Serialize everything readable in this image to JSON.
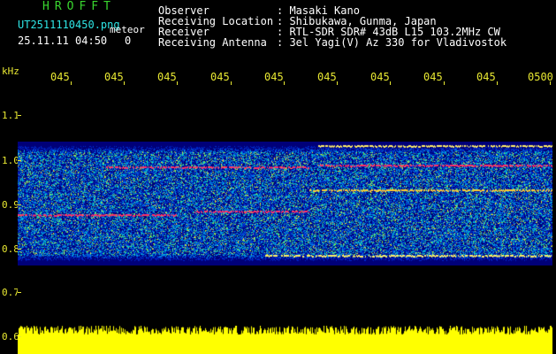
{
  "header": {
    "app_title": "HROFFT",
    "filename": "UT2511110450.png",
    "meteor_label": "meteor",
    "datetime": "25.11.11 04:50",
    "count": "0",
    "fields": [
      {
        "label": "Observer",
        "value": ": Masaki Kano"
      },
      {
        "label": "Receiving Location",
        "value": ": Shibukawa, Gunma, Japan"
      },
      {
        "label": "Receiver",
        "value": ": RTL-SDR SDR# 43dB L15 103.2MHz CW"
      },
      {
        "label": "Receiving Antenna",
        "value": ": 3el Yagi(V) Az 330 for Vladivostok"
      }
    ]
  },
  "axis": {
    "unit": "kHz",
    "y_ticks": [
      "1.1",
      "1.0",
      "0.9",
      "0.8",
      "0.7",
      "0.6"
    ],
    "x_ticks": [
      "045",
      "045",
      "045",
      "045",
      "045",
      "045",
      "045",
      "045",
      "045",
      "0500"
    ]
  },
  "colors": {
    "background": "#000000",
    "axis": "#e8e832",
    "title": "#39d62f",
    "filename": "#2ee6e6",
    "meter": "#ffff00"
  }
}
